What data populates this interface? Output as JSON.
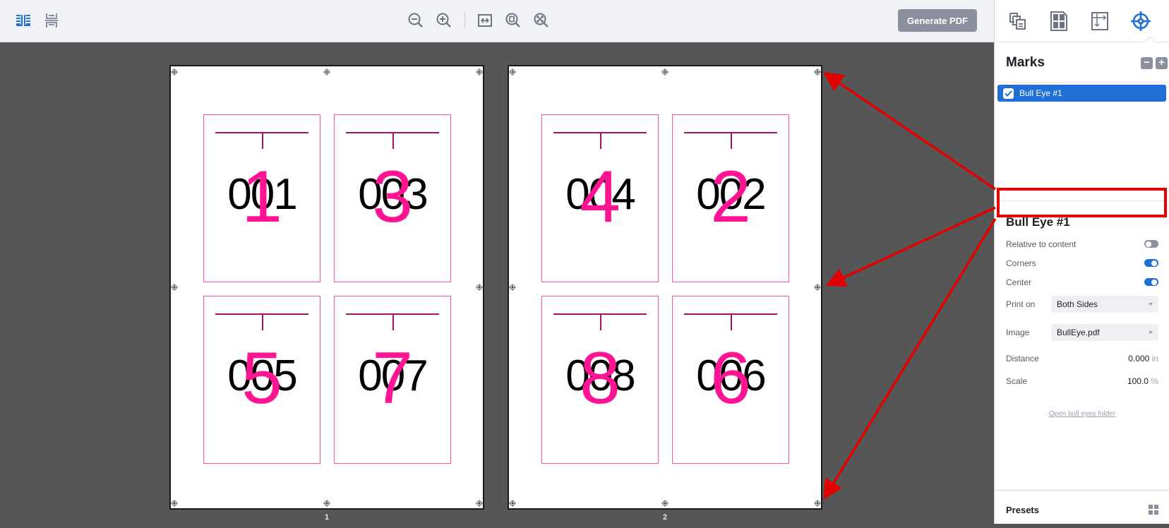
{
  "toolbar": {
    "left_icons": [
      "side-by-side-view-icon",
      "stacked-view-icon"
    ],
    "zoom_icons": [
      "zoom-out-icon",
      "zoom-in-icon",
      "fit-width-icon",
      "fit-page-icon",
      "zoom-actual-icon"
    ],
    "generate_label": "Generate PDF",
    "accent": "#1f6fd6",
    "button_gray": "#8b909e"
  },
  "sheets": [
    {
      "label": "1",
      "cards": [
        {
          "number": "001",
          "imposition": "1"
        },
        {
          "number": "003",
          "imposition": "3"
        },
        {
          "number": "005",
          "imposition": "5"
        },
        {
          "number": "007",
          "imposition": "7"
        }
      ]
    },
    {
      "label": "2",
      "cards": [
        {
          "number": "004",
          "imposition": "4"
        },
        {
          "number": "002",
          "imposition": "2"
        },
        {
          "number": "008",
          "imposition": "8"
        },
        {
          "number": "006",
          "imposition": "6"
        }
      ]
    }
  ],
  "panel": {
    "tabs": [
      "duplicate-pages-icon",
      "layout-grid-icon",
      "margins-icon",
      "marks-target-icon"
    ],
    "active_tab": "marks-target-icon",
    "marks": {
      "title": "Marks",
      "remove_label": "−",
      "add_label": "+",
      "items": [
        {
          "label": "Bull Eye #1",
          "checked": true,
          "selected": true
        }
      ]
    },
    "properties": {
      "title": "Bull Eye #1",
      "relative_to_content": {
        "label": "Relative to content",
        "on": false
      },
      "corners": {
        "label": "Corners",
        "on": true
      },
      "center": {
        "label": "Center",
        "on": true
      },
      "print_on": {
        "label": "Print on",
        "value": "Both Sides"
      },
      "image": {
        "label": "Image",
        "value": "BullEye.pdf"
      },
      "distance": {
        "label": "Distance",
        "value": "0.000",
        "unit": "in"
      },
      "scale": {
        "label": "Scale",
        "value": "100.0",
        "unit": "%"
      },
      "folder_link": "Open bull eyes folder"
    },
    "presets": {
      "label": "Presets"
    }
  },
  "annotation": {
    "color": "#e30000",
    "highlight": "Relative to content"
  }
}
